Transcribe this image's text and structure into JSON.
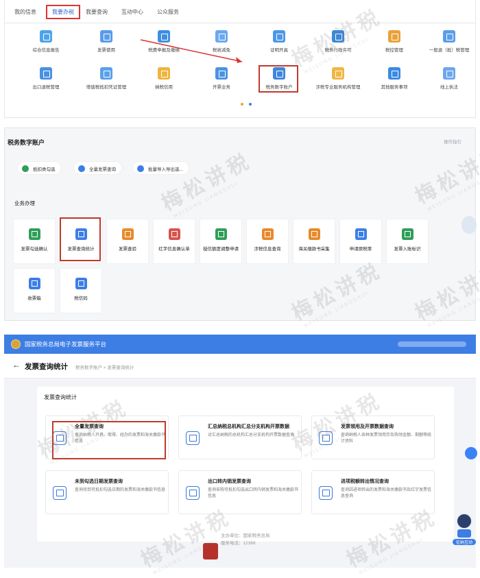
{
  "panel1": {
    "tabs": [
      "我的信息",
      "我要办税",
      "我要查询",
      "互动中心",
      "公众服务"
    ],
    "active_tab": "我要办税",
    "row1": [
      "综合信息报告",
      "发票使用",
      "税费申报及缴纳",
      "税收减免",
      "证明开具",
      "税务行政许可",
      "税控管理",
      "一般退（抵）税管理"
    ],
    "row2": [
      "出口退税管理",
      "增值税抵扣凭证管理",
      "纳税信用",
      "开票业务",
      "税务数字账户",
      "涉税专业服务机构管理",
      "其他服务事项",
      "线上执法"
    ],
    "highlight": "税务数字账户"
  },
  "panel2": {
    "title": "税务数字账户",
    "help": "操作指引",
    "pills": [
      "抵扣类勾选",
      "全量发票查询",
      "批量导入导出选..."
    ],
    "section": "业务办理",
    "row1": [
      "发票勾选确认",
      "发票查询统计",
      "发票查验",
      "红字信息确认单",
      "授信额度调整申请",
      "涉税信息查询",
      "海关缴款书采集",
      "申请原税率",
      "发票入账标识"
    ],
    "row2": [
      "收票箱",
      "税信码"
    ],
    "highlight": "发票查询统计"
  },
  "panel3": {
    "platform": "国家税务总局电子发票服务平台",
    "page_title": "发票查询统计",
    "breadcrumb": "税务数字账户 > 发票查询统计",
    "section": "发票查询统计",
    "cards": [
      {
        "title": "全量发票查询",
        "desc": "查询纳税人开具、取得、经办的发票和海关缴款书信息"
      },
      {
        "title": "汇总纳税总机构汇总分支机构开票数据",
        "desc": "对汇总纳税的总机构汇总分支机构开票数据查询"
      },
      {
        "title": "发票领用及开票数据查询",
        "desc": "查询纳税人各种发票领用存及购领金额、剩额等统计资料"
      },
      {
        "title": "未到勾选日期发票查询",
        "desc": "查询待到可抵扣勾选日期的发票和海关缴款书信息"
      },
      {
        "title": "出口转内销发票查询",
        "desc": "查询采购可抵扣勾选出口转内销发票和海关缴款书信息"
      },
      {
        "title": "进项税额转出情况查询",
        "desc": "查询因进项转出的发票和海关缴款书及红字发票信息查询"
      }
    ],
    "footer_line1": "主办单位：国家税务总局",
    "footer_line2": "服务电话：12366",
    "robot_label": "征纳互动"
  },
  "watermark": "梅松讲税",
  "watermark_sub": "MEISONG JIANGSHUI",
  "colors": {
    "accent": "#3d7ee5",
    "highlight_border": "#c0392b"
  }
}
